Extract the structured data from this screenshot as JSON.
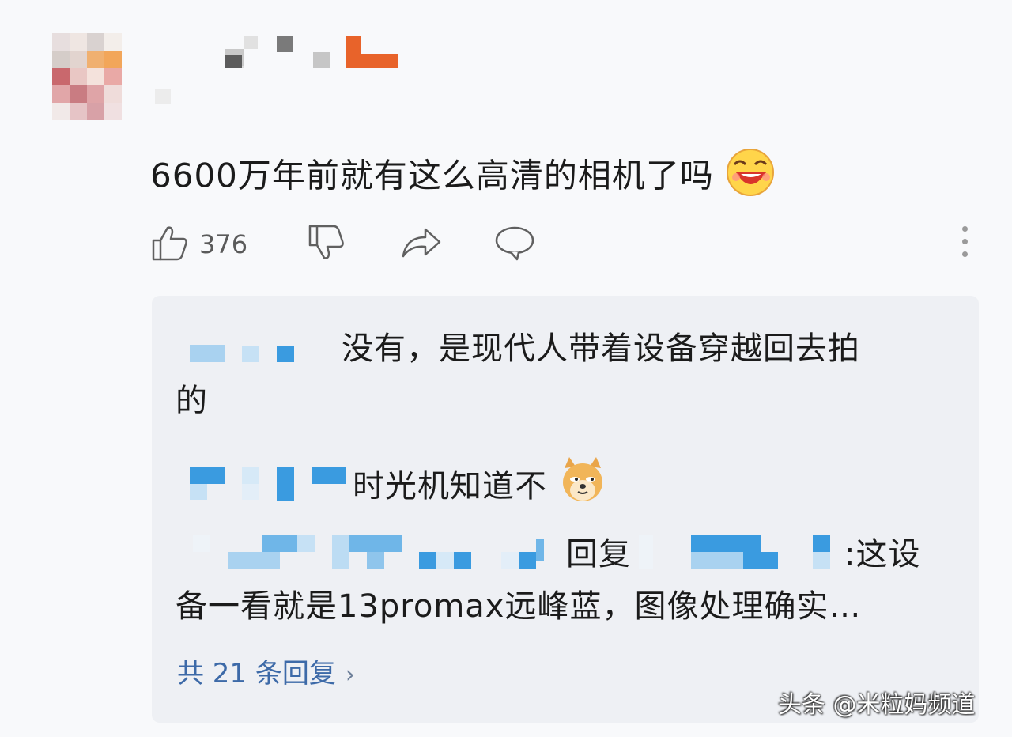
{
  "comment": {
    "text": "6600万年前就有这么高清的相机了吗",
    "emoji_icon": "laughing-face-emoji"
  },
  "actions": {
    "like_count": "376",
    "like_icon": "thumbs-up-icon",
    "dislike_icon": "thumbs-down-icon",
    "share_icon": "share-arrow-icon",
    "reply_icon": "speech-bubble-icon",
    "more_icon": "vertical-ellipsis-icon"
  },
  "replies": [
    {
      "text_line1": "没有，是现代人带着设备穿越回去拍",
      "text_line2": "的"
    },
    {
      "text": "时光机知道不",
      "emoji_icon": "doge-emoji"
    },
    {
      "reply_word": "回复",
      "text_tail": ":这设",
      "text_line2": "备一看就是13promax远峰蓝，图像处理确实…"
    }
  ],
  "view_replies": {
    "label": "共 21 条回复",
    "chevron": "›"
  },
  "watermark": {
    "text": "头条 @米粒妈频道"
  },
  "colors": {
    "background": "#f8f9fb",
    "reply_box": "#eef0f4",
    "link_blue": "#3d6aa8",
    "name_blur_blue": "#3a9be0",
    "username_orange": "#e8632a"
  }
}
